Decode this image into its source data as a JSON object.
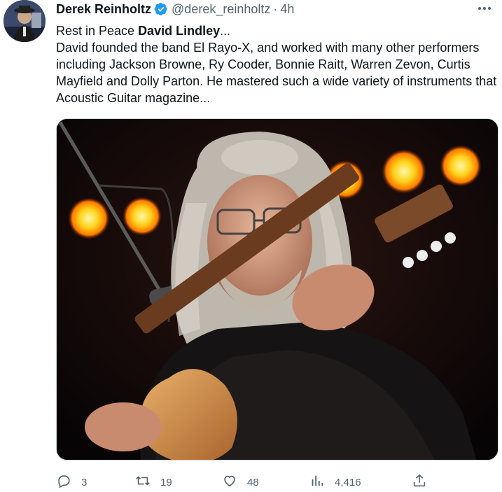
{
  "author": {
    "display_name": "Derek Reinholtz",
    "handle": "@derek_reinholtz",
    "separator": "·",
    "time": "4h",
    "verified_color": "#1d9bf0"
  },
  "tweet": {
    "line1_prefix": "Rest in Peace ",
    "line1_bold": "David Lindley",
    "line1_suffix": "...",
    "paragraph": "David founded the band El Rayo-X, and worked with many other performers including Jackson Browne, Ry Cooder, Bonnie Raitt, Warren Zevon, Curtis Mayfield and Dolly Parton. He mastered such a wide variety of instruments that Acoustic Guitar magazine..."
  },
  "actions": {
    "replies": "3",
    "retweets": "19",
    "likes": "48",
    "views": "4,416"
  },
  "icons": {
    "more": "more-icon",
    "reply": "reply-icon",
    "retweet": "retweet-icon",
    "like": "like-icon",
    "views": "views-icon",
    "share": "share-icon"
  },
  "colors": {
    "text": "#0f1419",
    "muted": "#536471",
    "accent": "#1d9bf0"
  }
}
